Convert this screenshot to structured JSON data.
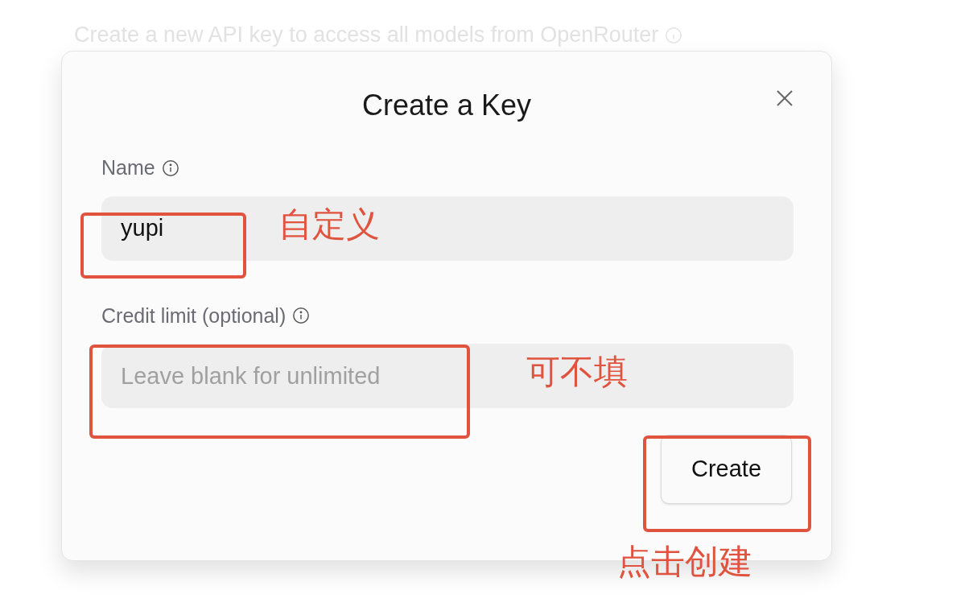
{
  "background_text": "Create a new API key to access all models from OpenRouter",
  "dialog": {
    "title": "Create a Key",
    "fields": [
      {
        "label": "Name",
        "value": "yupi"
      },
      {
        "label": "Credit limit (optional)",
        "placeholder": "Leave blank for unlimited"
      }
    ],
    "submit": "Create"
  },
  "annotations": [
    {
      "text": "自定义"
    },
    {
      "text": "可不填"
    },
    {
      "text": "点击创建"
    }
  ]
}
